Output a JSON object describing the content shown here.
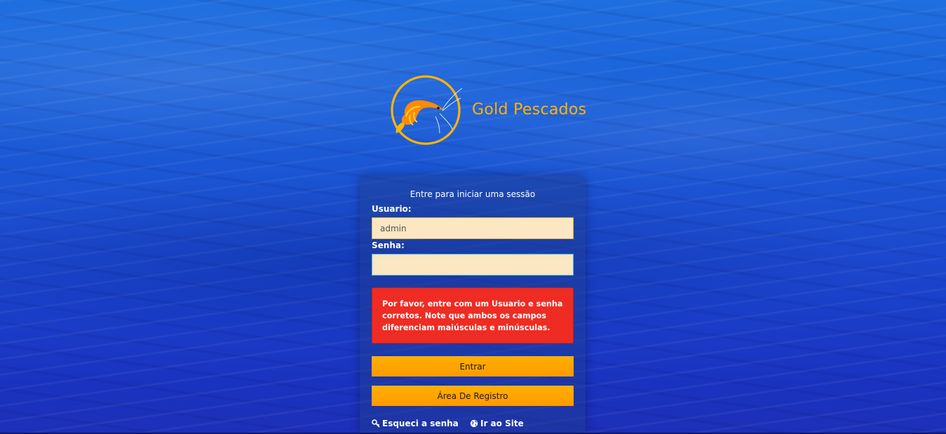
{
  "brand": {
    "name": "Gold Pescados",
    "icon": "shrimp-logo-icon",
    "colors": {
      "gold": "#ffb400",
      "orange": "#ff8a00"
    }
  },
  "login": {
    "message": "Entre para iniciar uma sessão",
    "username_label": "Usuario:",
    "username_value": "admin",
    "password_label": "Senha:",
    "password_value": "",
    "error": "Por favor, entre com um Usuario e senha corretos. Note que ambos os campos diferenciam maiúsculas e minúsculas.",
    "submit_label": "Entrar",
    "register_label": "Área De Registro",
    "forgot_icon": "key-icon",
    "forgot_label": "Esqueci a senha",
    "site_icon": "globe-icon",
    "site_label": "Ir ao Site"
  },
  "colors": {
    "error_bg": "#ee2c23",
    "button_bg": "#ffa500",
    "input_bg": "#fbe7c2",
    "background": "#1a4fd0"
  }
}
